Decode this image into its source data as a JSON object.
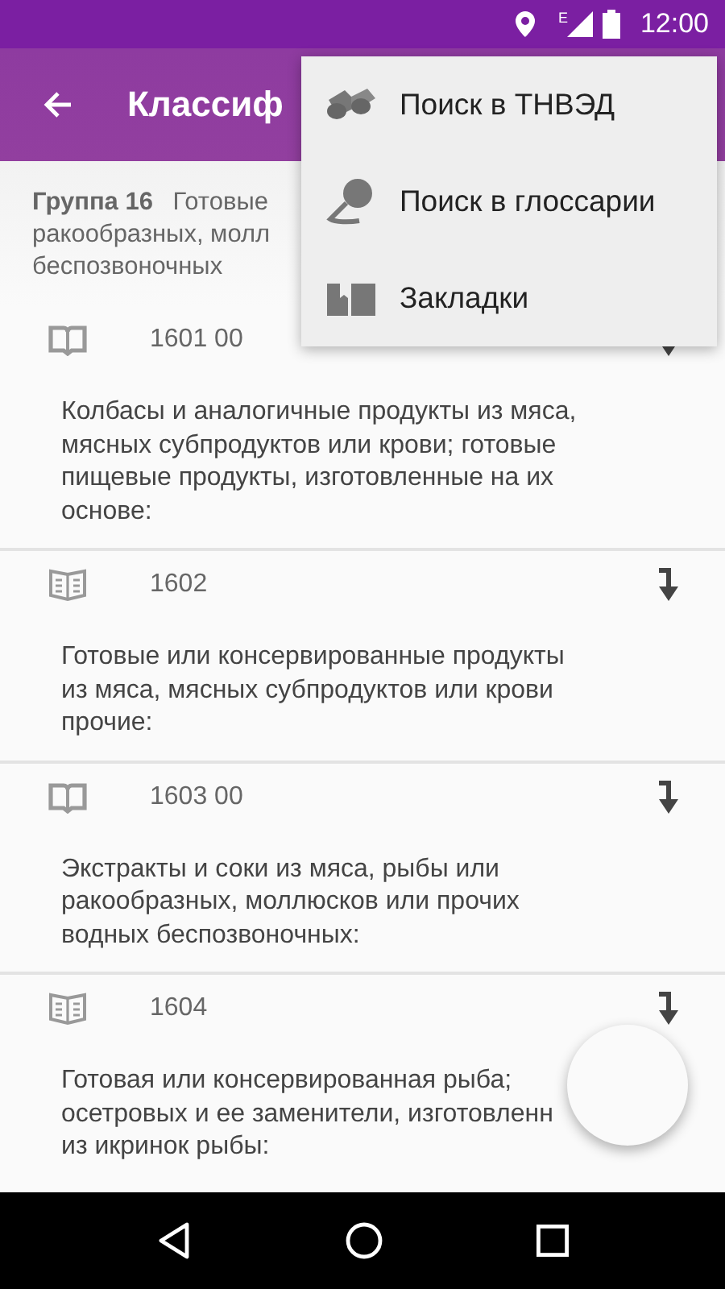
{
  "status_bar": {
    "network": "E",
    "time": "12:00"
  },
  "app_bar": {
    "title": "Классиф"
  },
  "group_header": {
    "label": "Группа 16",
    "lines": [
      "Готовые",
      "ракообразных, молл",
      "беспозвоночных"
    ]
  },
  "rows": [
    {
      "code": "1601 00",
      "kind": "open",
      "lines": [
        "Колбасы и аналогичные продукты из мяса,",
        "мясных субпродуктов или крови; готовые",
        "пищевые продукты, изготовленные на их",
        "основе:"
      ]
    },
    {
      "code": "1602",
      "kind": "lined",
      "lines": [
        "Готовые или консервированные продукты",
        "из мяса, мясных субпродуктов или крови",
        "прочие:"
      ]
    },
    {
      "code": "1603 00",
      "kind": "open",
      "lines": [
        "Экстракты и соки из мяса, рыбы или",
        "ракообразных, моллюсков или прочих",
        "водных беспозвоночных:"
      ]
    },
    {
      "code": "1604",
      "kind": "lined",
      "lines": [
        "Готовая или консервированная рыба;",
        "осетровых и ее заменители, изготовленн",
        "из икринок рыбы:"
      ]
    }
  ],
  "menu": [
    {
      "label": "Поиск в ТНВЭД",
      "kind": "binoculars"
    },
    {
      "label": "Поиск в глоссарии",
      "kind": "magnifier"
    },
    {
      "label": "Закладки",
      "kind": "bookmarks"
    }
  ]
}
